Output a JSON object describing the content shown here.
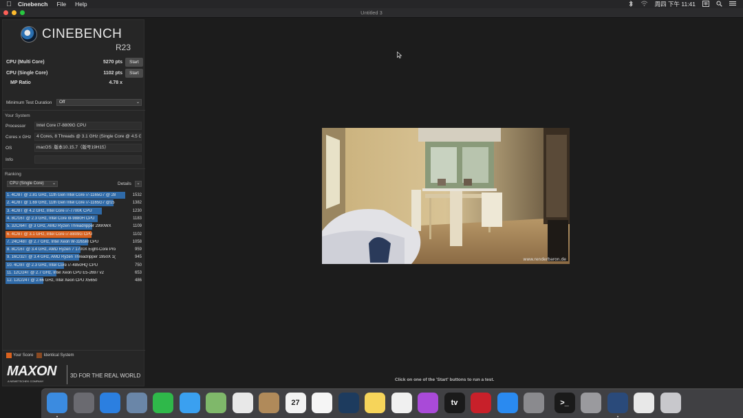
{
  "menubar": {
    "app_name": "Cinebench",
    "items": [
      "File",
      "Help"
    ],
    "status_icons": [
      "bluetooth-icon",
      "wifi-icon",
      "input-method-icon",
      "search-icon",
      "control-center-icon"
    ],
    "clock": "周四 下午 11:41"
  },
  "window": {
    "title": "Untitled 3",
    "traffic_lights": {
      "close": "#fe5f57",
      "minimize": "#febc2e",
      "zoom": "#28c840"
    }
  },
  "logo": {
    "name": "CINEBENCH",
    "version": "R23"
  },
  "scores": [
    {
      "label": "CPU (Multi Core)",
      "value": "5270 pts",
      "button": "Start"
    },
    {
      "label": "CPU (Single Core)",
      "value": "1102 pts",
      "button": "Start"
    },
    {
      "label": "MP Ratio",
      "value": "4.78 x"
    }
  ],
  "min_test": {
    "label": "Minimum Test Duration",
    "value": "Off"
  },
  "your_system": {
    "header": "Your System",
    "rows": [
      {
        "key": "Processor",
        "value": "Intel Core i7-8809G CPU"
      },
      {
        "key": "Cores x GHz",
        "value": "4 Cores, 8 Threads @ 3.1 GHz (Single Core @ 4.5 GHz)"
      },
      {
        "key": "OS",
        "value": "macOS: 版本10.15.7（版号19H15）"
      },
      {
        "key": "Info",
        "value": ""
      }
    ]
  },
  "ranking": {
    "header": "Ranking",
    "selector": "CPU (Single Core)",
    "details_label": "Details",
    "rows": [
      {
        "text": "1. 4C/8T @ 2.81 GHz, 11th Gen Intel Core i7-1165G7 @ 28",
        "score": 1532,
        "me": false
      },
      {
        "text": "2. 4C/8T @ 1.69 GHz, 11th Gen Intel Core i7-1165G7 @15",
        "score": 1382,
        "me": false
      },
      {
        "text": "3. 4C/8T @ 4.2 GHz, Intel Core i7-7700K CPU",
        "score": 1230,
        "me": false
      },
      {
        "text": "4. 8C/16T @ 2.3 GHz, Intel Core i9-9880H CPU",
        "score": 1183,
        "me": false
      },
      {
        "text": "5. 32C/64T @ 3 GHz, AMD Ryzen Threadripper 2990WX",
        "score": 1109,
        "me": false
      },
      {
        "text": "6. 4C/8T @ 3.1 GHz, Intel Core i7-8809G CPU",
        "score": 1102,
        "me": true
      },
      {
        "text": "7. 24C/48T @ 2.7 GHz, Intel Xeon W-3265M CPU",
        "score": 1058,
        "me": false
      },
      {
        "text": "8. 8C/16T @ 3.4 GHz, AMD Ryzen 7 1700X Eight-Core Pro",
        "score": 959,
        "me": false
      },
      {
        "text": "9. 16C/32T @ 3.4 GHz, AMD Ryzen Threadripper 1950X 1(",
        "score": 945,
        "me": false
      },
      {
        "text": "10. 4C/8T @ 2.3 GHz, Intel Core i7-4850HQ CPU",
        "score": 750,
        "me": false
      },
      {
        "text": "11. 12C/24T @ 2.7 GHz, Intel Xeon CPU E5-2697 v2",
        "score": 653,
        "me": false
      },
      {
        "text": "12. 12C/24T @ 2.66 GHz, Intel Xeon CPU X5650",
        "score": 486,
        "me": false
      }
    ],
    "colors": {
      "bar": "#2f6aa8",
      "me": "#d9621f",
      "identical": "#8a4a22"
    }
  },
  "legend": {
    "your_score": "Your Score",
    "identical": "Identical System"
  },
  "maxon": {
    "brand": "MAXON",
    "sub": "A NEMETSCHEK COMPANY",
    "tagline": "3D FOR THE REAL WORLD"
  },
  "render": {
    "watermark": "www.renderbaron.de"
  },
  "status": "Click on one of the 'Start' buttons to run a test.",
  "dock": {
    "apps": [
      {
        "name": "finder-icon",
        "color": "#3b8be0",
        "running": true
      },
      {
        "name": "launchpad-icon",
        "color": "#6a6a70",
        "running": false
      },
      {
        "name": "safari-icon",
        "color": "#2b7fe0",
        "running": false
      },
      {
        "name": "mail-icon",
        "color": "#6a86a8",
        "running": false
      },
      {
        "name": "facetime-icon",
        "color": "#2fb84a",
        "running": false
      },
      {
        "name": "messages-icon",
        "color": "#3aa0f0",
        "running": false
      },
      {
        "name": "maps-icon",
        "color": "#7fb86a",
        "running": false
      },
      {
        "name": "photos-icon",
        "color": "#e8e8e8",
        "running": false
      },
      {
        "name": "contacts-icon",
        "color": "#b08a5a",
        "running": false
      },
      {
        "name": "calendar-icon",
        "color": "#f2f2f2",
        "running": false
      },
      {
        "name": "reminders-icon",
        "color": "#f5f5f5",
        "running": false
      },
      {
        "name": "steam-icon",
        "color": "#1d3b5e",
        "running": false
      },
      {
        "name": "notes-icon",
        "color": "#f6d45a",
        "running": false
      },
      {
        "name": "music-icon",
        "color": "#f0f0f0",
        "running": false
      },
      {
        "name": "podcasts-icon",
        "color": "#a94ad8",
        "running": false
      },
      {
        "name": "apple-tv-icon",
        "color": "#1a1a1a",
        "running": false
      },
      {
        "name": "red-app-icon",
        "color": "#c8202a",
        "running": false
      },
      {
        "name": "app-store-icon",
        "color": "#2a8af0",
        "running": false
      },
      {
        "name": "system-preferences-icon",
        "color": "#8a8a8e",
        "running": false
      },
      {
        "name": "terminal-icon",
        "color": "#1a1a1a",
        "running": false
      },
      {
        "name": "disk-utility-icon",
        "color": "#9a9a9e",
        "running": false
      },
      {
        "name": "cinebench-icon",
        "color": "#2a4a7a",
        "running": true
      },
      {
        "name": "downloads-icon",
        "color": "#e8e8e8",
        "running": false
      },
      {
        "name": "trash-icon",
        "color": "#c8c8cc",
        "running": false
      }
    ],
    "glyphs": {
      "calendar-icon": "27",
      "apple-tv-icon": "tv",
      "terminal-icon": ">_"
    }
  }
}
